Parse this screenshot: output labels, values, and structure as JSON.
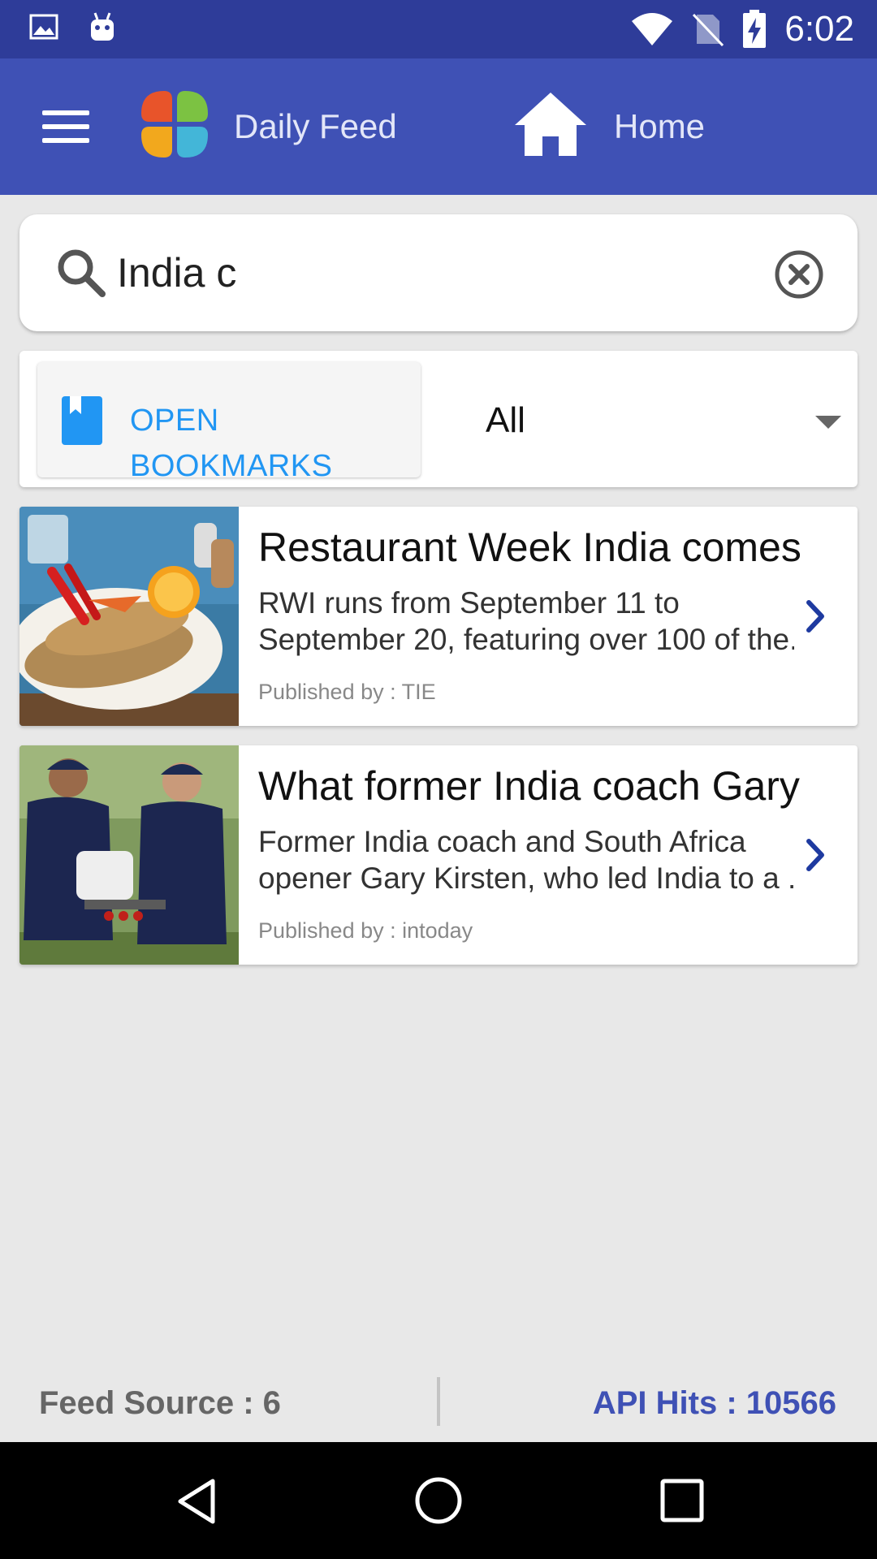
{
  "status_bar": {
    "time": "6:02",
    "icons": [
      "image-icon",
      "android-icon",
      "wifi-icon",
      "no-sim-icon",
      "battery-charging-icon"
    ]
  },
  "app_bar": {
    "title": "Daily Feed",
    "home_label": "Home",
    "color": "#3f51b5"
  },
  "search": {
    "value": "India c",
    "placeholder": ""
  },
  "filters": {
    "bookmarks_label": "OPEN BOOKMARKS",
    "category_value": "All"
  },
  "feed": [
    {
      "title": "Restaurant Week India comes ...",
      "desc_line1": "RWI runs from September 11 to",
      "desc_line2": "September 20, featuring over 100 of the...",
      "publisher": "Published by : TIE"
    },
    {
      "title": "What former India coach Gary ...",
      "desc_line1": "Former India coach and South Africa",
      "desc_line2": "opener Gary Kirsten, who led India to a ...",
      "publisher": "Published by : intoday"
    }
  ],
  "footer": {
    "feed_source": "Feed Source : 6",
    "api_hits": "API Hits : 10566"
  },
  "colors": {
    "accent": "#2196f3",
    "primary": "#3f51b5",
    "status_bar": "#2e3c99"
  }
}
